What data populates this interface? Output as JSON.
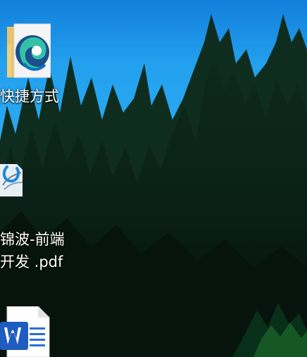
{
  "desktop": {
    "icons": [
      {
        "label": "快捷方式",
        "icon": "edge-shortcut-icon"
      },
      {
        "label_line1": "锦波-前端",
        "label_line2": "开发 .pdf",
        "icon": "pdf-reader-icon"
      },
      {
        "label": "",
        "icon": "word-document-icon"
      }
    ]
  },
  "colors": {
    "sky": "#1a8ee6",
    "forest": "#07150e",
    "word_blue": "#1f5cbf",
    "label_text": "#ffffff"
  }
}
